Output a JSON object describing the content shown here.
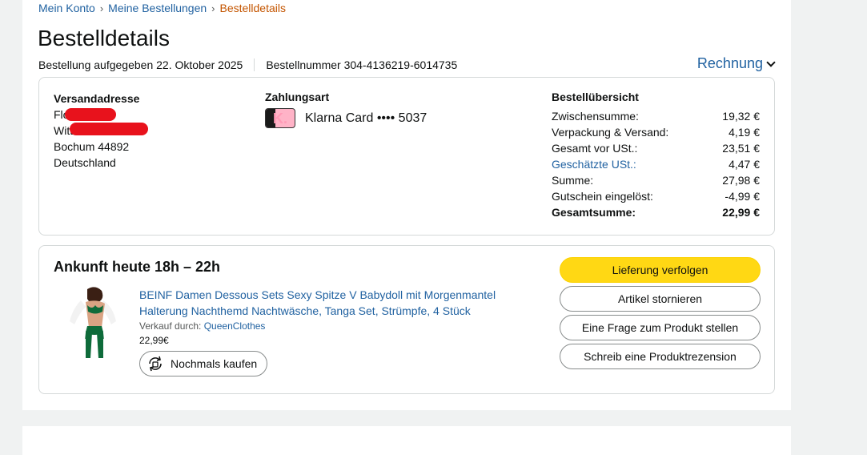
{
  "breadcrumb": {
    "account": "Mein Konto",
    "orders": "Meine Bestellungen",
    "current": "Bestelldetails"
  },
  "page_title": "Bestelldetails",
  "order_meta": {
    "placed": "Bestellung aufgegeben 22. Oktober 2025",
    "number": "Bestellnummer 304-4136219-6014735"
  },
  "invoice_label": "Rechnung",
  "shipping": {
    "heading": "Versandadresse",
    "line1": "Flo",
    "line2": "Witt",
    "line3": "Bochum 44892",
    "line4": "Deutschland"
  },
  "payment": {
    "heading": "Zahlungsart",
    "method": "Klarna Card •••• 5037",
    "icon": "klarna-card-icon"
  },
  "summary": {
    "heading": "Bestellübersicht",
    "rows": [
      {
        "label": "Zwischensumme:",
        "value": "19,32 €"
      },
      {
        "label": "Verpackung & Versand:",
        "value": "4,19 €"
      },
      {
        "label": "Gesamt vor USt.:",
        "value": "23,51 €"
      },
      {
        "label": "Geschätzte USt.:",
        "value": "4,47 €"
      },
      {
        "label": "Summe:",
        "value": "27,98 €"
      },
      {
        "label": "Gutschein eingelöst:",
        "value": "-4,99 €"
      },
      {
        "label": "Gesamtsumme:",
        "value": "22,99 €"
      }
    ]
  },
  "delivery": {
    "title": "Ankunft heute 18h – 22h",
    "product": {
      "title": "BEINF Damen Dessous Sets Sexy Spitze V Babydoll mit Morgenmantel Halterung Nachthemd Nachtwäsche, Tanga Set, Strümpfe, 4 Stück",
      "seller_prefix": "Verkauf durch: ",
      "seller": "QueenClothes",
      "price": "22,99€",
      "rebuy": "Nochmals kaufen"
    },
    "actions": {
      "track": "Lieferung verfolgen",
      "cancel": "Artikel stornieren",
      "question": "Eine Frage zum Produkt stellen",
      "review": "Schreib eine Produktrezension"
    }
  },
  "colors": {
    "link": "#2162a1",
    "primary_button": "#ffd814",
    "breadcrumb_current": "#c45500"
  }
}
